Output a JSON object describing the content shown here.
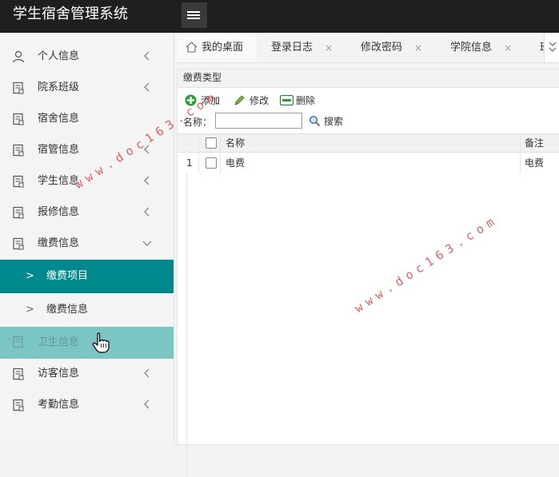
{
  "app": {
    "title": "学生宿舍管理系统"
  },
  "sidebar": {
    "items": [
      {
        "label": "个人信息",
        "icon": "user-icon",
        "chevron": "left"
      },
      {
        "label": "院系班级",
        "icon": "document-icon",
        "chevron": "left"
      },
      {
        "label": "宿舍信息",
        "icon": "document-icon",
        "chevron": ""
      },
      {
        "label": "宿管信息",
        "icon": "document-icon",
        "chevron": "left"
      },
      {
        "label": "学生信息",
        "icon": "document-icon",
        "chevron": "left"
      },
      {
        "label": "报修信息",
        "icon": "document-icon",
        "chevron": "left"
      },
      {
        "label": "缴费信息",
        "icon": "document-icon",
        "chevron": "down"
      }
    ],
    "subitems": [
      {
        "label": "缴费项目",
        "arrow": ">",
        "active": true
      },
      {
        "label": "缴费信息",
        "arrow": ">",
        "active": false
      }
    ],
    "hover_item": {
      "label": "卫生信息",
      "icon": "document-icon"
    },
    "items_bottom": [
      {
        "label": "访客信息",
        "icon": "document-icon",
        "chevron": "left"
      },
      {
        "label": "考勤信息",
        "icon": "document-icon",
        "chevron": "left"
      }
    ]
  },
  "tabs": [
    {
      "label": "我的桌面",
      "icon": "home-icon",
      "closable": false
    },
    {
      "label": "登录日志",
      "closable": true
    },
    {
      "label": "修改密码",
      "closable": true
    },
    {
      "label": "学院信息",
      "closable": true
    },
    {
      "label": "班级",
      "closable": false
    }
  ],
  "tab_close_glyph": "×",
  "panel": {
    "title": "缴费类型"
  },
  "toolbar": {
    "add_label": "添加",
    "edit_label": "修改",
    "delete_label": "删除"
  },
  "search": {
    "label": "名称：",
    "value": "",
    "button_label": "搜索"
  },
  "table": {
    "columns": [
      "名称",
      "备注"
    ],
    "rows": [
      {
        "index": "1",
        "name": "电费",
        "remark": "电费"
      }
    ]
  },
  "watermark": {
    "text": "www.doc163.com"
  },
  "colors": {
    "topbar": "#1f1f1f",
    "active_menu": "#00898c",
    "hover_menu": "#6fc1bf",
    "add_icon": "#2e9b3a",
    "watermark": "#d24848"
  }
}
